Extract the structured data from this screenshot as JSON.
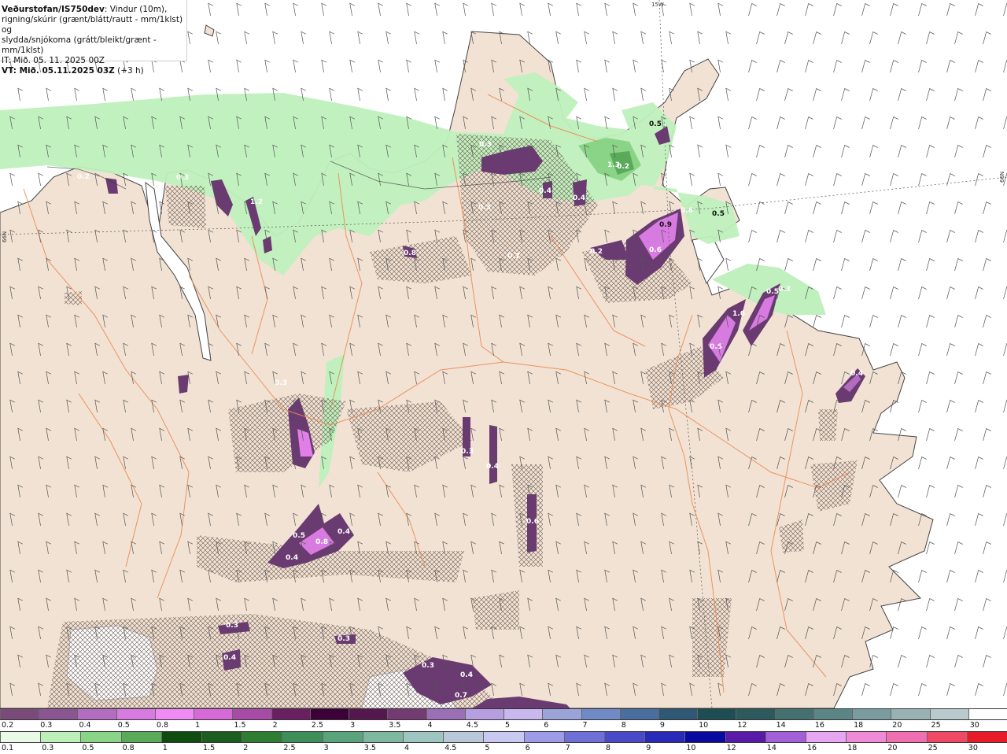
{
  "header": {
    "title": "Veðurstofan/IS750dev",
    "description_1": ": Vindur (10m),",
    "description_2": "rigning/skúrir (grænt/blátt/rautt - mm/1klst) og",
    "description_3": "slydda/snjókoma (grátt/bleikt/grænt - mm/1klst)",
    "issue_time": "IT: Mið. 05. 11. 2025 00Z",
    "valid_time": "VT: Mið. 05.11.2025 03Z",
    "lead": " (+3 h)"
  },
  "graticule": {
    "lon_label": "15W",
    "lat_label_left": "66N",
    "lat_label_right": "66N"
  },
  "map_labels": [
    "0.5",
    "1.3",
    "0.2",
    "0.6",
    "0.5",
    "0.9",
    "0.6",
    "0.2",
    "0.3",
    "0.4",
    "0.4",
    "0.3",
    "0.3",
    "0.2",
    "0.8",
    "0.7",
    "1.2",
    "1.6",
    "0.5",
    "0.5",
    "0.3",
    "0.4",
    "0.3",
    "0.4",
    "0.6",
    "0.5",
    "0.8",
    "0.4",
    "0.4",
    "0.3",
    "0.4",
    "0.3",
    "0.3",
    "0.4",
    "0.7",
    "0.3"
  ],
  "colors": {
    "land": "#f1e2d3",
    "sea": "#ffffff",
    "rain_light": "#bff0bd",
    "snow_mid": "#6a3b70",
    "snow_high": "#e27ee8",
    "roads": "#ee8a55",
    "coast": "#444444"
  },
  "scale_snow": {
    "labels": [
      "0.2",
      "0.3",
      "0.4",
      "0.5",
      "0.8",
      "1",
      "1.5",
      "2",
      "2.5",
      "3",
      "3.5",
      "4",
      "4.5",
      "5",
      "6",
      "7",
      "8",
      "9",
      "10",
      "12",
      "14",
      "16",
      "18",
      "20",
      "25",
      "30"
    ],
    "colors": [
      "#7a4b7a",
      "#8a5590",
      "#b46cc0",
      "#d77be0",
      "#f08af5",
      "#d66ad8",
      "#a84ba6",
      "#6a2060",
      "#3d0038",
      "#54184e",
      "#743a72",
      "#9b6fb6",
      "#b79ee0",
      "#c8b8ef",
      "#9aa4d8",
      "#6f8ac4",
      "#4a6f9e",
      "#2e5874",
      "#1e4d54",
      "#2c5a5d",
      "#44706f",
      "#5c8585",
      "#7a9c9e",
      "#98b2b4",
      "#b8cacc",
      "#ffffff"
    ]
  },
  "scale_rain": {
    "labels": [
      "0.1",
      "0.3",
      "0.5",
      "0.8",
      "1",
      "1.5",
      "2",
      "2.5",
      "3",
      "3.5",
      "4",
      "4.5",
      "5",
      "6",
      "7",
      "8",
      "9",
      "10",
      "12",
      "14",
      "16",
      "18",
      "20",
      "25",
      "30"
    ],
    "colors": [
      "#e9fbe6",
      "#bdf0b8",
      "#8ad488",
      "#5aaa5a",
      "#0f4d0f",
      "#1b5e20",
      "#2e7d32",
      "#3f8f5a",
      "#5aa47c",
      "#7fb8a0",
      "#9fc5c0",
      "#b8c8d8",
      "#c8c8f0",
      "#9c9ce8",
      "#6f6fd8",
      "#4a4ac8",
      "#2a2ab8",
      "#0a0aa0",
      "#5a1aa8",
      "#a35fd8",
      "#e7a6f2",
      "#ee8ad6",
      "#ef6fb0",
      "#ee4a66",
      "#e81c28"
    ]
  }
}
